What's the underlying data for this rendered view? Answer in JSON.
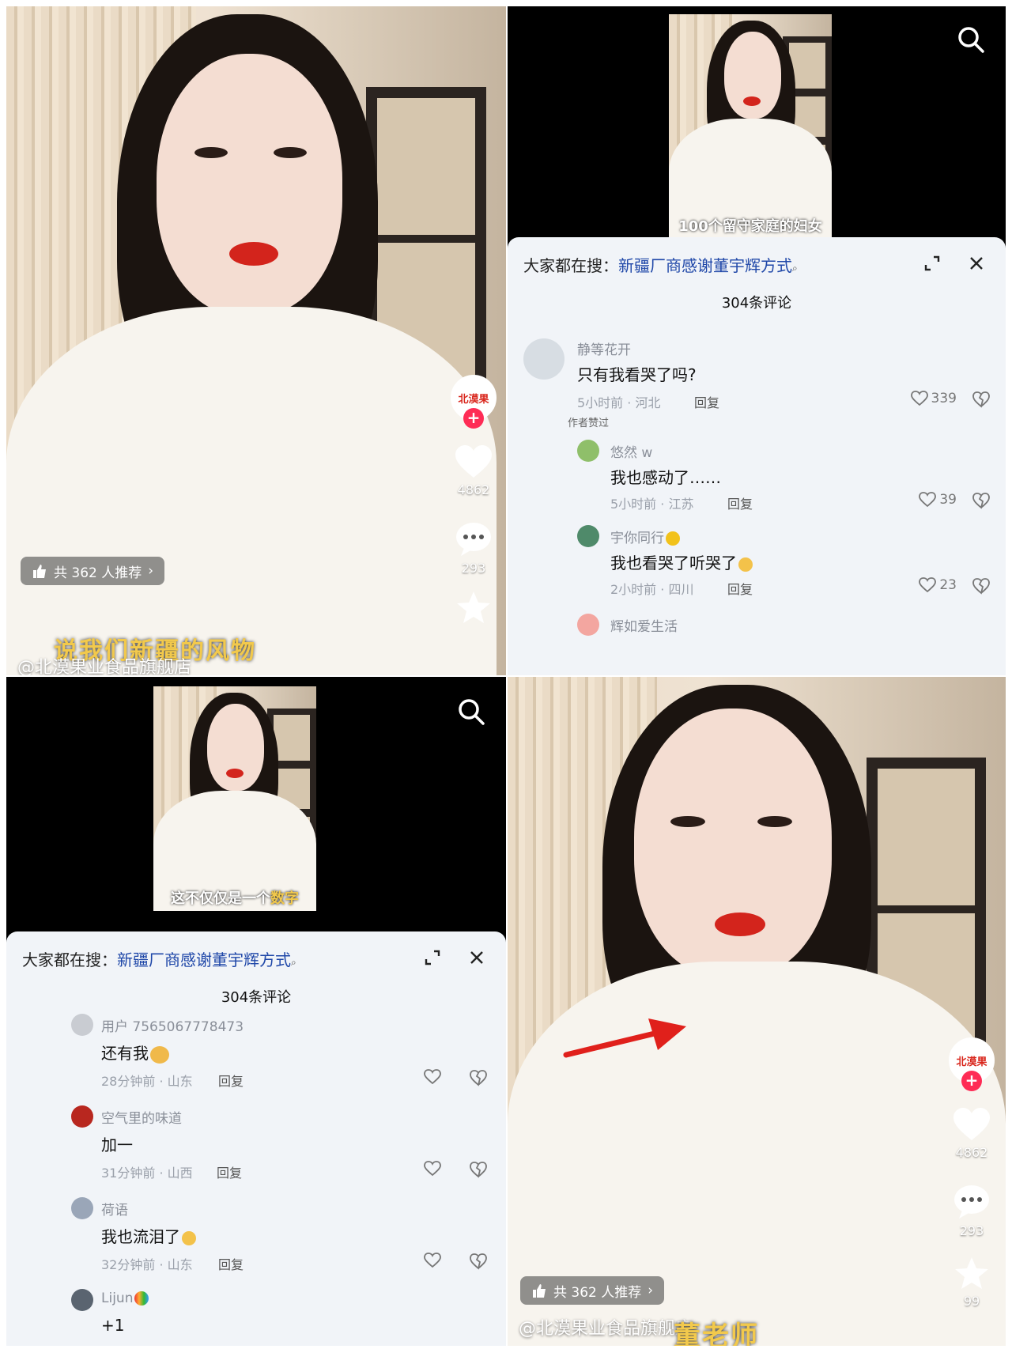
{
  "video": {
    "recommend_label": "共 362 人推荐",
    "like_count": "4862",
    "comment_count": "293",
    "star_count": "99",
    "author": "@北漠果业食品旗舰店",
    "brand_badge": "北漠果",
    "subtitle_top_left": "说我们新疆的风物",
    "subtitle_bottom_right": "董老师"
  },
  "comments_panel": {
    "search_prefix": "大家都在搜：",
    "search_term": "新疆厂商感谢董宇辉方式",
    "count_label": "304条评论",
    "mini_subtitle_a": "100个留守家庭的妇女",
    "mini_subtitle_b_plain": "这不仅仅是一个",
    "mini_subtitle_b_hl": "数字",
    "reply_label": "回复"
  },
  "thread_a": [
    {
      "user": "静等花开",
      "text": "只有我看哭了吗?",
      "meta": "5小时前 · 河北",
      "likes": "339",
      "badge": "作者赞过"
    },
    {
      "user": "悠然 w",
      "text": "我也感动了……",
      "meta": "5小时前 · 江苏",
      "likes": "39"
    },
    {
      "user": "宇你同行",
      "text": "我也看哭了听哭了",
      "meta": "2小时前 · 四川",
      "likes": "23"
    },
    {
      "user": "辉如爱生活",
      "text": "",
      "meta": "",
      "likes": ""
    }
  ],
  "thread_b": [
    {
      "user": "用户 7565067778473",
      "text": "还有我",
      "meta": "28分钟前 · 山东"
    },
    {
      "user": "空气里的味道",
      "text": "加一",
      "meta": "31分钟前 · 山西"
    },
    {
      "user": "荷语",
      "text": "我也流泪了",
      "meta": "32分钟前 · 山东"
    },
    {
      "user": "Lijun",
      "text": "+1",
      "meta": ""
    }
  ],
  "colors": {
    "accent": "#fe2c55",
    "hot_search": "#1f47a8",
    "arrow": "#e0201b",
    "subtitle": "#f2c94c"
  }
}
